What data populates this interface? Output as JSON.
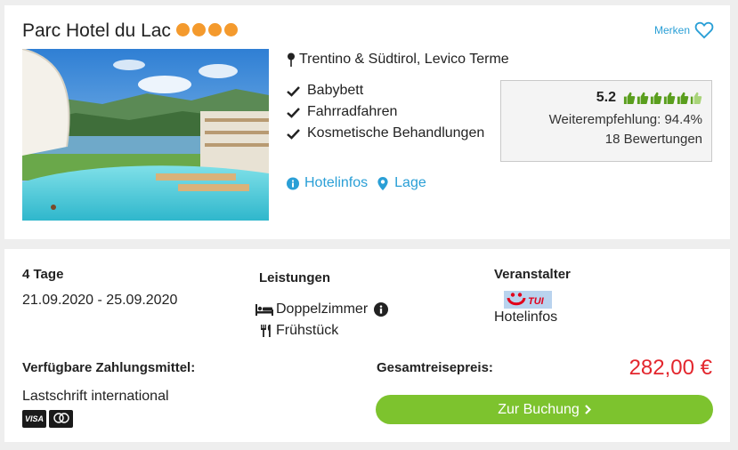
{
  "hotel": {
    "name": "Parc Hotel du Lac",
    "star_count": 4,
    "star_color": "#f49a2d",
    "favorite_label": "Merken",
    "favorite_icon": "heart-outline-icon",
    "location": "Trentino & Südtirol, Levico Terme",
    "amenities": [
      "Babybett",
      "Fahrradfahren",
      "Kosmetische Behandlungen"
    ],
    "links": {
      "info_label": "Hotelinfos",
      "map_label": "Lage"
    },
    "accent_color": "#2a9fd6"
  },
  "rating": {
    "score": "5.2",
    "thumbs_max": 6,
    "thumbs_filled": 5.2,
    "thumb_color": "#5a9e1e",
    "recommendation": "Weiterempfehlung: 94.4%",
    "review_count": "18 Bewertungen"
  },
  "offer": {
    "duration": "4 Tage",
    "dates": "21.09.2020 - 25.09.2020",
    "services_label": "Leistungen",
    "services": [
      "Doppelzimmer",
      "Frühstück"
    ],
    "operator_label": "Veranstalter",
    "operator_logo_text": "TUI",
    "operator_link": "Hotelinfos",
    "payment_label": "Verfügbare Zahlungsmittel:",
    "payment_method": "Lastschrift international",
    "card_logos": [
      "VISA",
      "Mastercard"
    ],
    "total_label": "Gesamtreisepreis:",
    "price": "282,00 €",
    "price_color": "#e3262d",
    "booking_label": "Zur Buchung",
    "booking_color": "#7dc32e"
  }
}
